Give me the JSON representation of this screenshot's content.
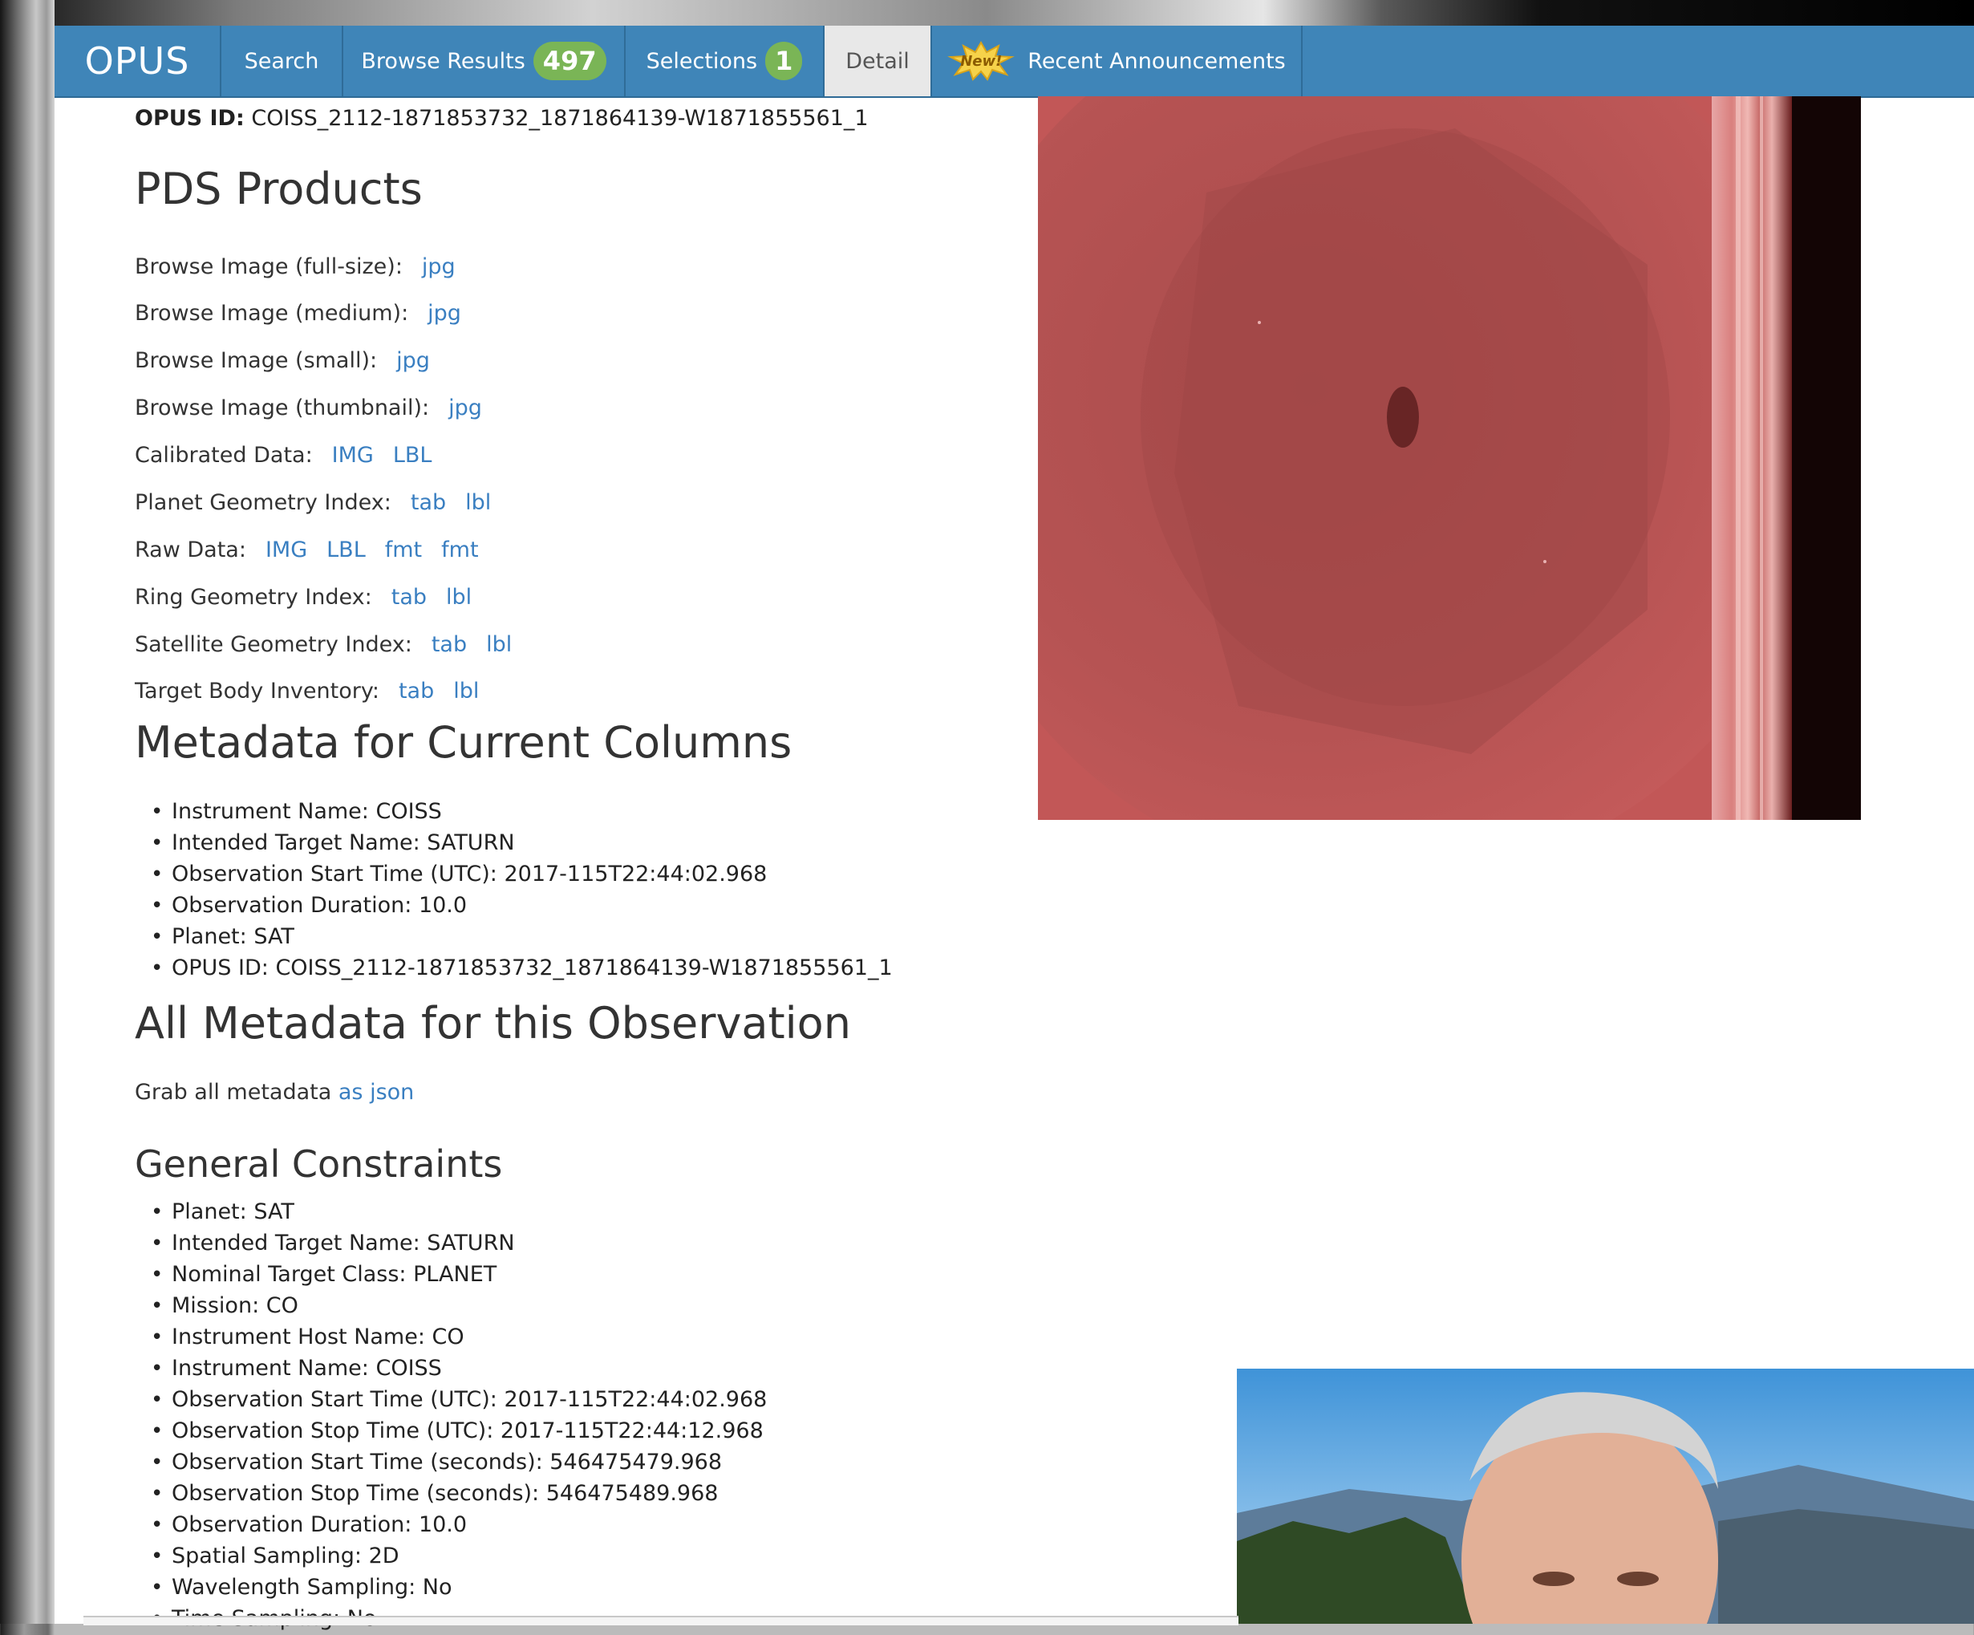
{
  "nav": {
    "brand": "OPUS",
    "search": "Search",
    "browse_label": "Browse Results",
    "browse_count": "497",
    "selections_label": "Selections",
    "selections_count": "1",
    "detail": "Detail",
    "new_badge": "New!",
    "announcements": "Recent Announcements"
  },
  "opus_id": {
    "label": "OPUS ID:",
    "value": "COISS_2112-1871853732_1871864139-W1871855561_1"
  },
  "pds": {
    "heading": "PDS Products",
    "rows": [
      {
        "label": "Browse Image (full-size):",
        "links": [
          "jpg"
        ]
      },
      {
        "label": "Browse Image (medium):",
        "links": [
          "jpg"
        ]
      },
      {
        "label": "Browse Image (small):",
        "links": [
          "jpg"
        ]
      },
      {
        "label": "Browse Image (thumbnail):",
        "links": [
          "jpg"
        ]
      },
      {
        "label": "Calibrated Data:",
        "links": [
          "IMG",
          "LBL"
        ]
      },
      {
        "label": "Planet Geometry Index:",
        "links": [
          "tab",
          "lbl"
        ]
      },
      {
        "label": "Raw Data:",
        "links": [
          "IMG",
          "LBL",
          "fmt",
          "fmt"
        ]
      },
      {
        "label": "Ring Geometry Index:",
        "links": [
          "tab",
          "lbl"
        ]
      },
      {
        "label": "Satellite Geometry Index:",
        "links": [
          "tab",
          "lbl"
        ]
      },
      {
        "label": "Target Body Inventory:",
        "links": [
          "tab",
          "lbl"
        ]
      }
    ]
  },
  "current_columns": {
    "heading": "Metadata for Current Columns",
    "items": [
      "Instrument Name: COISS",
      "Intended Target Name: SATURN",
      "Observation Start Time (UTC): 2017-115T22:44:02.968",
      "Observation Duration: 10.0",
      "Planet: SAT",
      "OPUS ID: COISS_2112-1871853732_1871864139-W1871855561_1"
    ]
  },
  "all_metadata": {
    "heading": "All Metadata for this Observation",
    "grab_text": "Grab all metadata ",
    "grab_link": "as json"
  },
  "general": {
    "heading": "General Constraints",
    "items": [
      "Planet: SAT",
      "Intended Target Name: SATURN",
      "Nominal Target Class: PLANET",
      "Mission: CO",
      "Instrument Host Name: CO",
      "Instrument Name: COISS",
      "Observation Start Time (UTC): 2017-115T22:44:02.968",
      "Observation Stop Time (UTC): 2017-115T22:44:12.968",
      "Observation Start Time (seconds): 546475479.968",
      "Observation Stop Time (seconds): 546475489.968",
      "Observation Duration: 10.0",
      "Spatial Sampling: 2D",
      "Wavelength Sampling: No",
      "Time Sampling: No"
    ]
  },
  "colors": {
    "nav_bg": "#3f85b8",
    "badge": "#7ab556",
    "link": "#3a7fc1",
    "detail_tab": "#e8e8e8"
  }
}
